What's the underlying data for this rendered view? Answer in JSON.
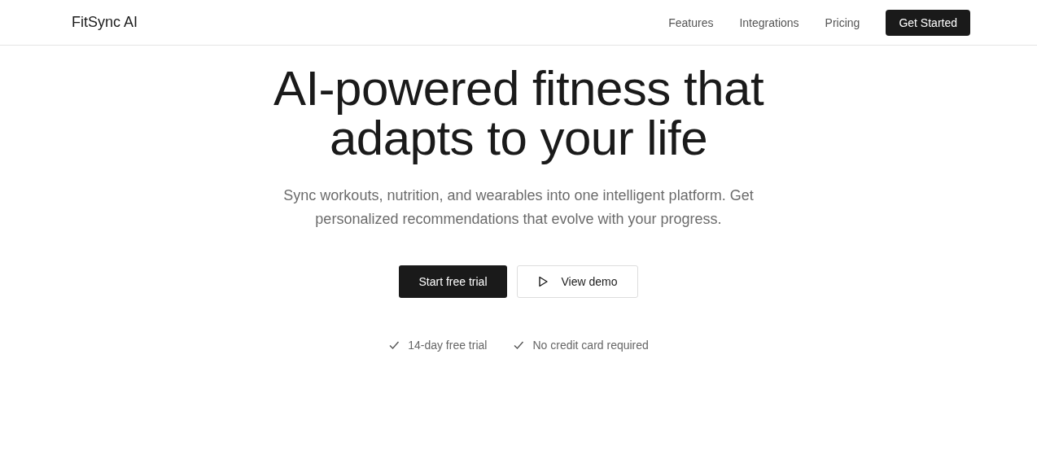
{
  "header": {
    "logo": "FitSync AI",
    "nav": [
      {
        "label": "Features"
      },
      {
        "label": "Integrations"
      },
      {
        "label": "Pricing"
      }
    ],
    "cta": "Get Started"
  },
  "hero": {
    "title_lines": [
      "AI-powered fitness that",
      "adapts to your life"
    ],
    "subtitle": "Sync workouts, nutrition, and wearables into one intelligent platform. Get personalized recommendations that evolve with your progress.",
    "buttons": [
      {
        "label": "Start free trial",
        "kind": "primary"
      },
      {
        "label": "View demo",
        "kind": "secondary"
      }
    ],
    "checks": [
      "14-day free trial",
      "No credit card required"
    ]
  }
}
